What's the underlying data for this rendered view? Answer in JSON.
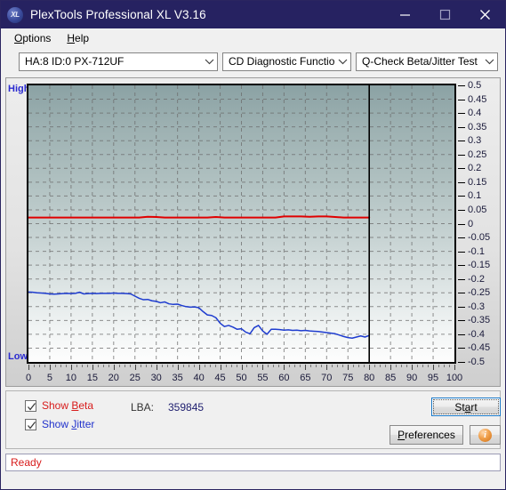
{
  "window": {
    "title": "PlexTools Professional XL V3.16",
    "app_icon": "xl-logo-icon",
    "minimize": "minimize-icon",
    "maximize": "maximize-icon",
    "close": "close-icon"
  },
  "menu": {
    "items": [
      {
        "label": "Options",
        "accel": "O"
      },
      {
        "label": "Help",
        "accel": "H"
      }
    ]
  },
  "toolbar": {
    "drive": {
      "value": "HA:8 ID:0  PX-712UF",
      "arrow": "chevron-down-icon"
    },
    "function": {
      "value": "CD Diagnostic Functions",
      "arrow": "chevron-down-icon"
    },
    "test": {
      "value": "Q-Check Beta/Jitter Test",
      "arrow": "chevron-down-icon"
    }
  },
  "chart": {
    "left_top_label": "High",
    "left_bottom_label": "Low"
  },
  "chart_data": {
    "type": "line",
    "title": "Q-Check Beta/Jitter Test",
    "xlabel": "",
    "ylabel": "",
    "grid": true,
    "legend": "none",
    "xlim": [
      0,
      100
    ],
    "ylim": [
      -0.5,
      0.5
    ],
    "xticks": [
      0,
      5,
      10,
      15,
      20,
      25,
      30,
      35,
      40,
      45,
      50,
      55,
      60,
      65,
      70,
      75,
      80,
      85,
      90,
      95,
      100
    ],
    "yticks": [
      0.5,
      0.45,
      0.4,
      0.35,
      0.3,
      0.25,
      0.2,
      0.15,
      0.1,
      0.05,
      0,
      -0.05,
      -0.1,
      -0.15,
      -0.2,
      -0.25,
      -0.3,
      -0.35,
      -0.4,
      -0.45,
      -0.5
    ],
    "data_end_marker_x": 80,
    "series": [
      {
        "name": "Beta",
        "color": "#e00000",
        "x": [
          0,
          2,
          4,
          6,
          8,
          10,
          12,
          14,
          16,
          18,
          20,
          22,
          24,
          26,
          28,
          30,
          32,
          34,
          36,
          38,
          40,
          42,
          44,
          46,
          48,
          50,
          52,
          54,
          56,
          58,
          60,
          62,
          64,
          66,
          68,
          70,
          72,
          74,
          76,
          78,
          80
        ],
        "y": [
          0.022,
          0.022,
          0.022,
          0.022,
          0.022,
          0.022,
          0.022,
          0.022,
          0.022,
          0.022,
          0.022,
          0.022,
          0.022,
          0.022,
          0.025,
          0.024,
          0.022,
          0.022,
          0.022,
          0.022,
          0.022,
          0.022,
          0.024,
          0.022,
          0.022,
          0.022,
          0.022,
          0.022,
          0.022,
          0.022,
          0.026,
          0.026,
          0.026,
          0.025,
          0.026,
          0.026,
          0.024,
          0.022,
          0.022,
          0.022,
          0.022
        ]
      },
      {
        "name": "Jitter",
        "color": "#1e3ccf",
        "x": [
          0,
          1,
          2,
          3,
          4,
          5,
          6,
          7,
          8,
          9,
          10,
          11,
          12,
          13,
          14,
          15,
          16,
          17,
          18,
          19,
          20,
          21,
          22,
          23,
          24,
          25,
          26,
          27,
          28,
          29,
          30,
          31,
          32,
          33,
          34,
          35,
          36,
          37,
          38,
          39,
          40,
          41,
          42,
          43,
          44,
          45,
          46,
          47,
          48,
          49,
          50,
          51,
          52,
          53,
          54,
          55,
          56,
          57,
          58,
          59,
          60,
          61,
          62,
          63,
          64,
          65,
          66,
          67,
          68,
          69,
          70,
          71,
          72,
          73,
          74,
          75,
          76,
          77,
          78,
          79,
          80
        ],
        "y": [
          -0.247,
          -0.248,
          -0.25,
          -0.251,
          -0.252,
          -0.254,
          -0.255,
          -0.254,
          -0.253,
          -0.252,
          -0.253,
          -0.252,
          -0.248,
          -0.254,
          -0.253,
          -0.252,
          -0.253,
          -0.252,
          -0.252,
          -0.252,
          -0.251,
          -0.252,
          -0.252,
          -0.253,
          -0.254,
          -0.262,
          -0.27,
          -0.275,
          -0.274,
          -0.279,
          -0.281,
          -0.286,
          -0.283,
          -0.29,
          -0.292,
          -0.291,
          -0.296,
          -0.3,
          -0.302,
          -0.301,
          -0.304,
          -0.318,
          -0.33,
          -0.332,
          -0.34,
          -0.36,
          -0.372,
          -0.368,
          -0.374,
          -0.382,
          -0.38,
          -0.392,
          -0.398,
          -0.376,
          -0.368,
          -0.388,
          -0.4,
          -0.382,
          -0.382,
          -0.383,
          -0.385,
          -0.384,
          -0.386,
          -0.385,
          -0.387,
          -0.386,
          -0.388,
          -0.389,
          -0.39,
          -0.392,
          -0.394,
          -0.396,
          -0.398,
          -0.403,
          -0.408,
          -0.412,
          -0.414,
          -0.41,
          -0.406,
          -0.41,
          -0.404
        ]
      }
    ]
  },
  "controls": {
    "show_beta": {
      "label_pre": "Show ",
      "label_accel": "B",
      "label_post": "eta",
      "checked": true,
      "check_icon": "checkmark-icon"
    },
    "show_jitter": {
      "label_pre": "Show ",
      "label_accel": "J",
      "label_post": "itter",
      "checked": true,
      "check_icon": "checkmark-icon"
    },
    "lba_label": "LBA:",
    "lba_value": "359845",
    "start_button": {
      "pre": "St",
      "accel": "a",
      "post": "rt"
    },
    "preferences_button": {
      "pre": "",
      "accel": "P",
      "post": "references"
    },
    "info_button": {
      "glyph": "i",
      "icon": "info-icon"
    }
  },
  "status": {
    "text": "Ready"
  },
  "colors": {
    "titlebar": "#262261",
    "beta": "#e00000",
    "jitter": "#1e3ccf",
    "status": "#d81c1c",
    "accent_focus": "#1878c8"
  }
}
